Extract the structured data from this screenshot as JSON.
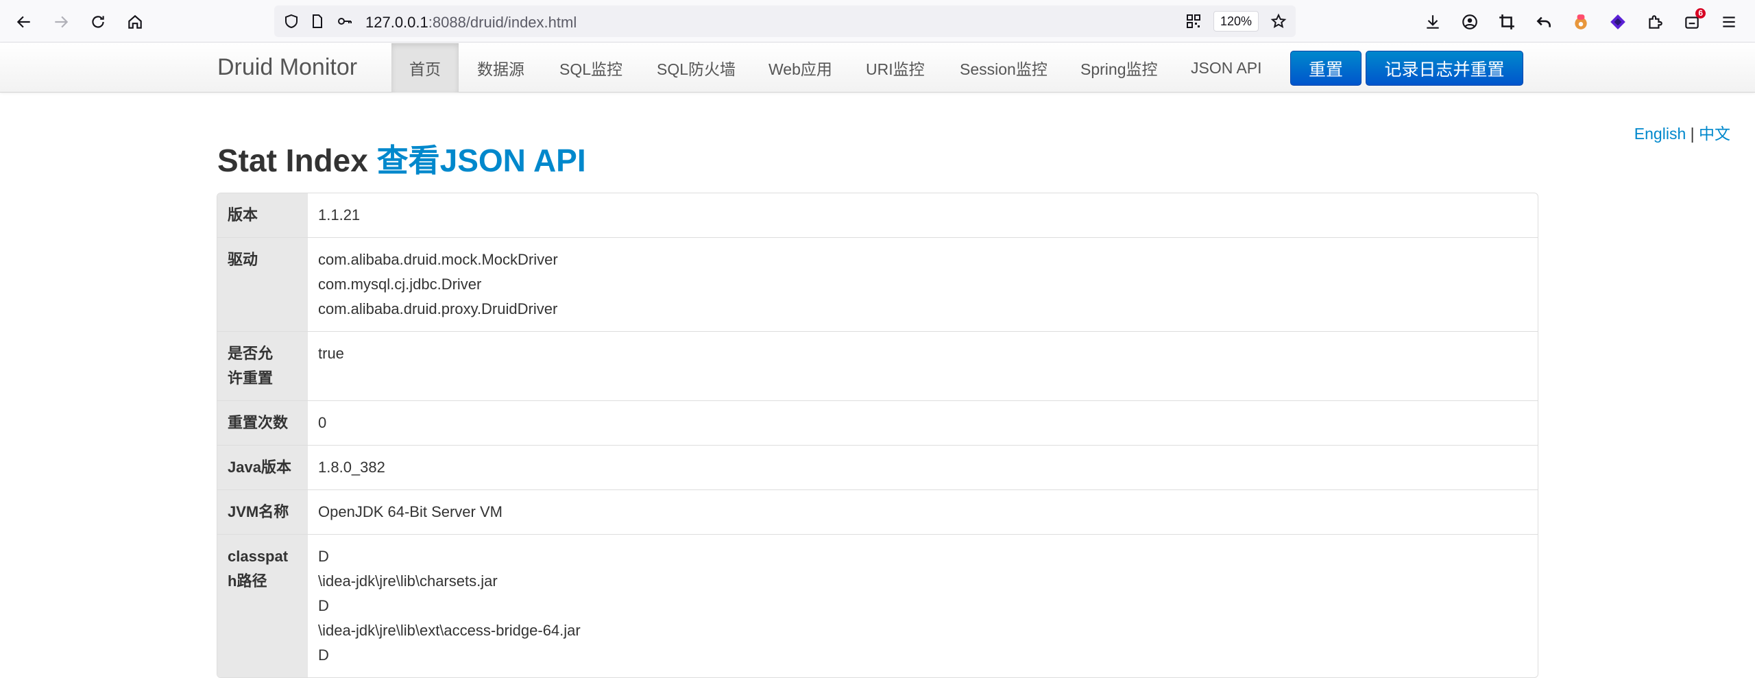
{
  "browser": {
    "url_host": "127.0.0.1",
    "url_rest": ":8088/druid/index.html",
    "zoom": "120%",
    "notification_count": "6"
  },
  "navbar": {
    "brand": "Druid Monitor",
    "items": [
      {
        "label": "首页",
        "active": true
      },
      {
        "label": "数据源"
      },
      {
        "label": "SQL监控"
      },
      {
        "label": "SQL防火墙"
      },
      {
        "label": "Web应用"
      },
      {
        "label": "URI监控"
      },
      {
        "label": "Session监控"
      },
      {
        "label": "Spring监控"
      },
      {
        "label": "JSON API"
      }
    ],
    "reset_label": "重置",
    "log_reset_label": "记录日志并重置"
  },
  "lang": {
    "english": "English",
    "separator": "|",
    "chinese": "中文"
  },
  "page": {
    "title": "Stat Index",
    "title_link": "查看JSON API"
  },
  "stats": {
    "version": {
      "key": "版本",
      "value": "1.1.21"
    },
    "drivers": {
      "key": "驱动",
      "values": [
        "com.alibaba.druid.mock.MockDriver",
        "com.mysql.cj.jdbc.Driver",
        "com.alibaba.druid.proxy.DruidDriver"
      ]
    },
    "reset_enable": {
      "key": "是否允许重置",
      "value": "true"
    },
    "reset_count": {
      "key": "重置次数",
      "value": "0"
    },
    "java_version": {
      "key": "Java版本",
      "value": "1.8.0_382"
    },
    "jvm_name": {
      "key": "JVM名称",
      "value": "OpenJDK 64-Bit Server VM"
    },
    "classpath": {
      "key": "classpath路径",
      "values": [
        "D",
        "\\idea-jdk\\jre\\lib\\charsets.jar",
        "D",
        "\\idea-jdk\\jre\\lib\\ext\\access-bridge-64.jar",
        "D"
      ]
    }
  },
  "colors": {
    "accent": "#0088cc",
    "button": "#0066cc",
    "key_bg": "#e8e8e8"
  }
}
